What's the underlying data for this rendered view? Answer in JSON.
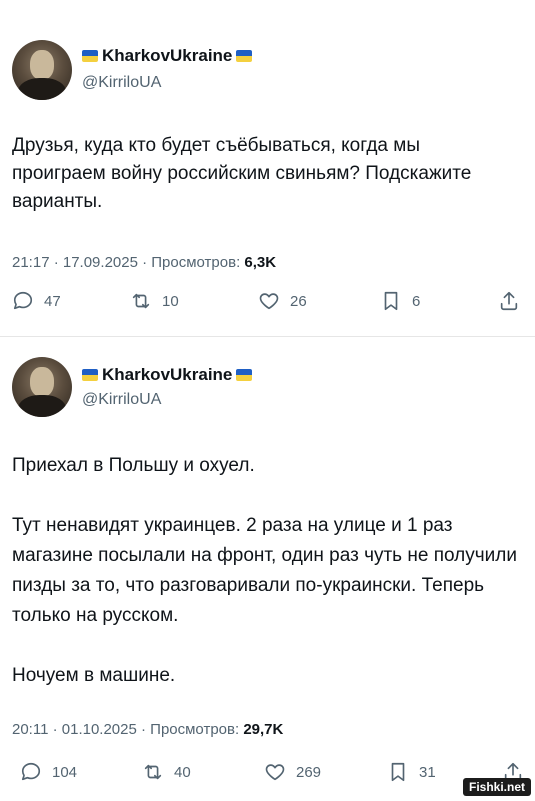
{
  "tweets": [
    {
      "display_name": "KharkovUkraine",
      "handle": "@KirriloUA",
      "text": "Друзья, куда кто будет съёбываться, когда мы проиграем войну российским свиньям? Подскажите варианты.",
      "timestamp": "21:17 · 17.09.2025 · Просмотров: ",
      "views": "6,3K",
      "replies": "47",
      "retweets": "10",
      "likes": "26",
      "bookmarks": "6"
    },
    {
      "display_name": "KharkovUkraine",
      "handle": "@KirriloUA",
      "text": "Приехал в Польшу и охуел.\n\nТут ненавидят украинцев. 2 раза на улице и 1 раз магазине посылали на фронт, один раз чуть не получили пизды за то, что разговаривали по-украински. Теперь только на русском.\n\nНочуем в машине.",
      "timestamp": "20:11 · 01.10.2025 · Просмотров: ",
      "views": "29,7K",
      "replies": "104",
      "retweets": "40",
      "likes": "269",
      "bookmarks": "31"
    }
  ],
  "watermark": "Fishki.net",
  "icons": {
    "reply": "reply-icon",
    "retweet": "retweet-icon",
    "like": "heart-icon",
    "bookmark": "bookmark-icon",
    "share": "share-icon"
  },
  "colors": {
    "text": "#0f1419",
    "secondary": "#536471",
    "flag_blue": "#1f5fc4",
    "flag_yellow": "#f4d03f"
  }
}
